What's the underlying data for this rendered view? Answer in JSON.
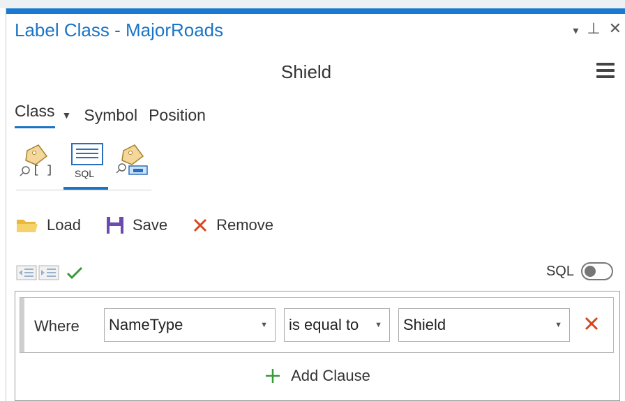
{
  "window": {
    "title": "Label Class - MajorRoads",
    "controls": {
      "menu": "▾",
      "pin": "⊥",
      "close": "✕"
    }
  },
  "panel": {
    "subtitle": "Shield"
  },
  "tabs": [
    {
      "label": "Class",
      "active": true,
      "has_dropdown": true
    },
    {
      "label": "Symbol",
      "active": false
    },
    {
      "label": "Position",
      "active": false
    }
  ],
  "mode_icons": [
    {
      "name": "label-expression-icon",
      "text": "[ ]"
    },
    {
      "name": "sql-query-icon",
      "text": "SQL",
      "selected": true
    },
    {
      "name": "label-visibility-icon",
      "text": ""
    }
  ],
  "actions": {
    "load": "Load",
    "save": "Save",
    "remove": "Remove"
  },
  "sql_toggle": {
    "label": "SQL",
    "on": false
  },
  "clause": {
    "where_label": "Where",
    "field": "NameType",
    "operator": "is equal to",
    "value": "Shield"
  },
  "add_clause": "Add Clause",
  "colors": {
    "accent": "#1a7ad2",
    "title": "#1a74c6",
    "remove": "#d6471e",
    "add": "#3a9a3a",
    "check": "#3a9a3a"
  }
}
